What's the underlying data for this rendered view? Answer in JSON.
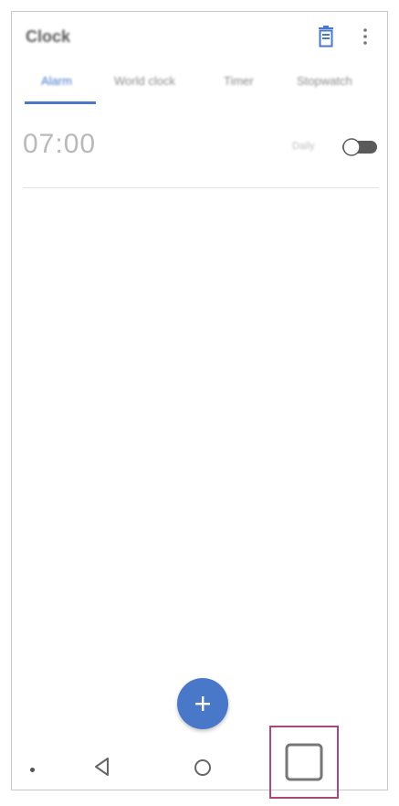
{
  "app": {
    "title": "Clock"
  },
  "header": {
    "delete_icon": "trash-icon",
    "more_icon": "more-vert-icon"
  },
  "tabs": [
    {
      "label": "Alarm",
      "active": true
    },
    {
      "label": "World clock",
      "active": false
    },
    {
      "label": "Timer",
      "active": false
    },
    {
      "label": "Stopwatch",
      "active": false
    }
  ],
  "alarms": [
    {
      "time": "07:00",
      "days": "Daily",
      "enabled": false
    }
  ],
  "fab": {
    "icon": "plus-icon"
  },
  "navbar": {
    "items": [
      "dot",
      "back-icon",
      "home-icon",
      "recents-icon"
    ]
  },
  "colors": {
    "accent": "#4a78c8",
    "highlight": "#a8487c"
  }
}
